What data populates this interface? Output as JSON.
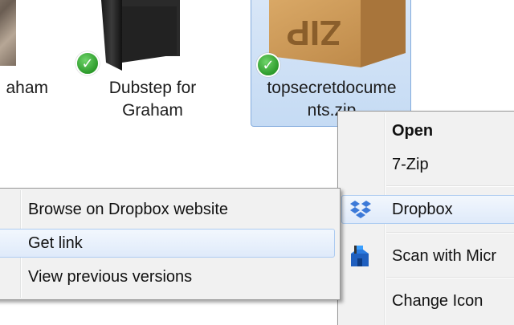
{
  "files": [
    {
      "id": "graham",
      "label": "aham",
      "synced": true
    },
    {
      "id": "dubstep",
      "label": "Dubstep for\nGraham",
      "synced": true
    },
    {
      "id": "zip",
      "label": "topsecretdocume\nnts.zip",
      "box_text": "ZIP",
      "synced": true,
      "selected": true
    }
  ],
  "context_menu": {
    "items": [
      {
        "label": "Open",
        "bold": true
      },
      {
        "label": "7-Zip"
      },
      {
        "label": "Dropbox",
        "icon": "dropbox-icon",
        "has_submenu": true,
        "highlighted": true
      },
      {
        "label": "Scan with Micr",
        "icon": "shield-icon"
      },
      {
        "label": "Change Icon"
      }
    ]
  },
  "dropbox_submenu": {
    "items": [
      {
        "label": "Browse on Dropbox website"
      },
      {
        "label": "Get link",
        "highlighted": true
      },
      {
        "label": "View previous versions"
      }
    ]
  },
  "colors": {
    "selection_bg": "#cfe0f5",
    "selection_border": "#84acdd",
    "menu_bg": "#f1f1f1",
    "hover_border": "#aeccf1",
    "sync_green": "#2c9a2a",
    "dropbox_blue": "#3d7ad8"
  }
}
